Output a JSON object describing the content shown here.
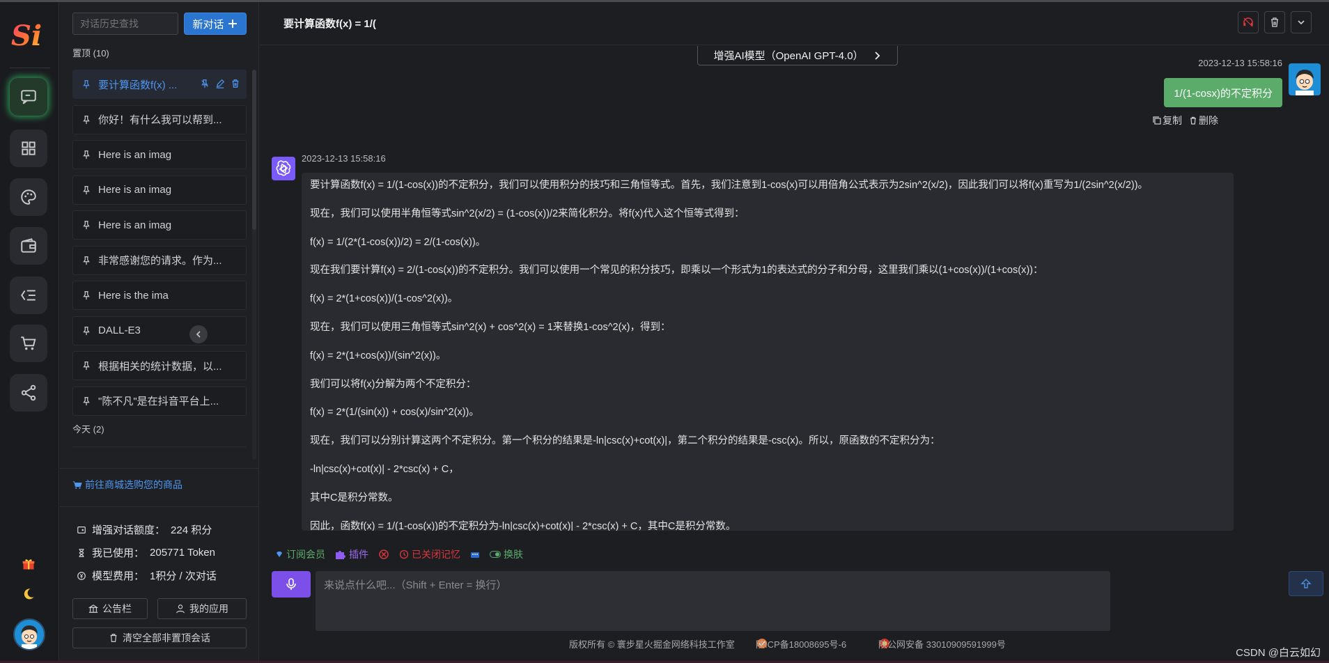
{
  "rail": {
    "logo_text": "Si",
    "items": [
      {
        "icon": "chat-icon",
        "active": true
      },
      {
        "icon": "apps-icon",
        "active": false
      },
      {
        "icon": "palette-icon",
        "active": false
      },
      {
        "icon": "wallet-icon",
        "active": false
      },
      {
        "icon": "outline-icon",
        "active": false
      },
      {
        "icon": "cart-icon",
        "active": false
      },
      {
        "icon": "share-icon",
        "active": false
      }
    ],
    "bottom": [
      "gift-icon",
      "moon-icon",
      "avatar"
    ]
  },
  "sidebar": {
    "search_placeholder": "对话历史查找",
    "new_chat_label": "新对话",
    "pinned_label": "置顶",
    "pinned_count": "(10)",
    "items": [
      {
        "label": "要计算函数f(x) ...",
        "selected": true
      },
      {
        "label": "你好！有什么我可以帮到...",
        "selected": false
      },
      {
        "label": "Here is an imag",
        "selected": false
      },
      {
        "label": "Here is an imag",
        "selected": false
      },
      {
        "label": "Here is an imag",
        "selected": false
      },
      {
        "label": "非常感谢您的请求。作为...",
        "selected": false
      },
      {
        "label": "Here is the ima",
        "selected": false
      },
      {
        "label": "DALL-E3",
        "selected": false
      },
      {
        "label": "根据相关的统计数据，以...",
        "selected": false
      },
      {
        "label": "\"陈不凡\"是在抖音平台上...",
        "selected": false
      }
    ],
    "today_label": "今天",
    "today_count": "(2)",
    "shop_link": "前往商城选购您的商品",
    "stats": [
      {
        "icon": "quota-icon",
        "label": "增强对话额度：",
        "value": "224 积分"
      },
      {
        "icon": "hourglass-icon",
        "label": "我已使用：",
        "value": "205771 Token"
      },
      {
        "icon": "fee-icon",
        "label": "模型费用：",
        "value": "1积分 / 次对话"
      }
    ],
    "notice_button": "公告栏",
    "apps_button": "我的应用",
    "clear_button": "清空全部非置顶会话"
  },
  "main": {
    "title": "要计算函数f(x) = 1/(",
    "model_label": "增强AI模型（OpenAI GPT-4.0）",
    "user_message": {
      "time": "2023-12-13 15:58:16",
      "text": "1/(1-cosx)的不定积分",
      "copy_label": "复制",
      "delete_label": "删除"
    },
    "ai_message": {
      "time": "2023-12-13 15:58:16",
      "paragraphs": [
        "要计算函数f(x) = 1/(1-cos(x))的不定积分，我们可以使用积分的技巧和三角恒等式。首先，我们注意到1-cos(x)可以用倍角公式表示为2sin^2(x/2)，因此我们可以将f(x)重写为1/(2sin^2(x/2))。",
        "现在，我们可以使用半角恒等式sin^2(x/2) = (1-cos(x))/2来简化积分。将f(x)代入这个恒等式得到：",
        "f(x) = 1/(2*(1-cos(x))/2) = 2/(1-cos(x))。",
        "现在我们要计算f(x) = 2/(1-cos(x))的不定积分。我们可以使用一个常见的积分技巧，即乘以一个形式为1的表达式的分子和分母，这里我们乘以(1+cos(x))/(1+cos(x))：",
        "f(x) = 2*(1+cos(x))/(1-cos^2(x))。",
        "现在，我们可以使用三角恒等式sin^2(x) + cos^2(x) = 1来替换1-cos^2(x)，得到：",
        "f(x) = 2*(1+cos(x))/(sin^2(x))。",
        "我们可以将f(x)分解为两个不定积分：",
        "f(x) = 2*(1/(sin(x)) + cos(x)/sin^2(x))。",
        "现在，我们可以分别计算这两个不定积分。第一个积分的结果是-ln|csc(x)+cot(x)|，第二个积分的结果是-csc(x)。所以，原函数的不定积分为：",
        "-ln|csc(x)+cot(x)| - 2*csc(x) + C，",
        "其中C是积分常数。",
        "因此，函数f(x) = 1/(1-cos(x))的不定积分为-ln|csc(x)+cot(x)| - 2*csc(x) + C，其中C是积分常数。"
      ]
    },
    "toolbar": {
      "subscribe": "订阅会员",
      "plugins": "插件",
      "memory": "已关闭记忆",
      "skin": "换肤"
    },
    "input_placeholder": "来说点什么吧...（Shift + Enter = 换行）",
    "footer": {
      "copyright": "版权所有 © 寰步星火掘金网络科技工作室",
      "icp": "陕ICP备18008695号-6",
      "police": "陕公网安备 33010909591999号"
    },
    "watermark": "CSDN @白云如幻"
  },
  "colors": {
    "accent_blue": "#2a75d0",
    "user_bubble": "#5bac6b",
    "mic_purple": "#7b4fe8",
    "memory_red": "#d9363e"
  }
}
